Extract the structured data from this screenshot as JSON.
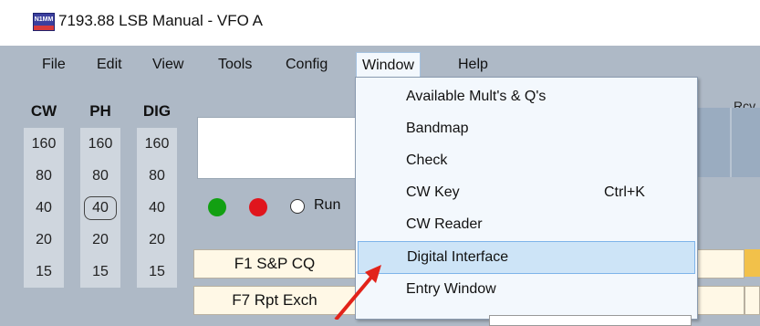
{
  "window": {
    "title": "7193.88 LSB Manual - VFO A",
    "icon_text": "N1MM"
  },
  "menubar": {
    "items": [
      "File",
      "Edit",
      "View",
      "Tools",
      "Config",
      "Window",
      "Help"
    ],
    "active": "Window"
  },
  "bands": {
    "headers": [
      "CW",
      "PH",
      "DIG"
    ],
    "rows": [
      "160",
      "80",
      "40",
      "20",
      "15"
    ],
    "selected": {
      "mode": "PH",
      "band": "40"
    }
  },
  "entry": {
    "run_label": "Run",
    "green_dot_color": "#12a012",
    "red_dot_color": "#e0151d",
    "rcv_label": "Rcv"
  },
  "function_keys": {
    "f1": "F1 S&P CQ",
    "f7": "F7 Rpt Exch"
  },
  "window_menu": {
    "items": [
      {
        "label": "Available Mult's & Q's",
        "shortcut": ""
      },
      {
        "label": "Bandmap",
        "shortcut": ""
      },
      {
        "label": "Check",
        "shortcut": ""
      },
      {
        "label": "CW Key",
        "shortcut": "Ctrl+K"
      },
      {
        "label": "CW Reader",
        "shortcut": ""
      },
      {
        "label": "Digital Interface",
        "shortcut": ""
      },
      {
        "label": "Entry Window",
        "shortcut": ""
      }
    ],
    "highlighted": "Digital Interface"
  },
  "annotation": {
    "arrow_color": "#e2231a"
  }
}
